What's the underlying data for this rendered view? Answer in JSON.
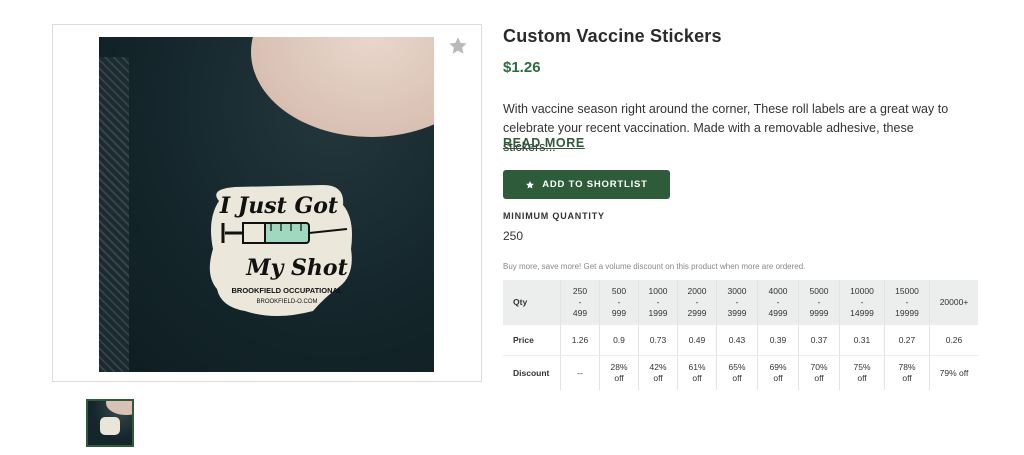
{
  "product": {
    "title": "Custom Vaccine Stickers",
    "price": "$1.26",
    "description": "With vaccine season right around the corner, These roll labels are a great way to celebrate your recent vaccination. Made with a removable adhesive, these stickers...",
    "read_more": "READ MORE",
    "add_to_shortlist": "ADD TO SHORTLIST",
    "min_quantity_label": "MINIMUM QUANTITY",
    "min_quantity_value": "250",
    "volume_note": "Buy more, save more! Get a volume discount on this product when more are ordered."
  },
  "gallery": {
    "sticker_text": {
      "line1": "I Just Got",
      "line2": "My Shot",
      "company": "BROOKFIELD OCCUPATIONAL",
      "website": "BROOKFIELD-O.COM"
    },
    "icons": {
      "favorite": "star-icon",
      "button": "star-icon"
    }
  },
  "pricing_table": {
    "row_labels": {
      "qty": "Qty",
      "price": "Price",
      "discount": "Discount"
    },
    "columns": [
      {
        "qty_top": "250",
        "qty_sep": "-",
        "qty_bottom": "499",
        "price": "1.26",
        "discount_top": "--",
        "discount_bottom": ""
      },
      {
        "qty_top": "500",
        "qty_sep": "-",
        "qty_bottom": "999",
        "price": "0.9",
        "discount_top": "28%",
        "discount_bottom": "off"
      },
      {
        "qty_top": "1000",
        "qty_sep": "-",
        "qty_bottom": "1999",
        "price": "0.73",
        "discount_top": "42%",
        "discount_bottom": "off"
      },
      {
        "qty_top": "2000",
        "qty_sep": "-",
        "qty_bottom": "2999",
        "price": "0.49",
        "discount_top": "61%",
        "discount_bottom": "off"
      },
      {
        "qty_top": "3000",
        "qty_sep": "-",
        "qty_bottom": "3999",
        "price": "0.43",
        "discount_top": "65%",
        "discount_bottom": "off"
      },
      {
        "qty_top": "4000",
        "qty_sep": "-",
        "qty_bottom": "4999",
        "price": "0.39",
        "discount_top": "69%",
        "discount_bottom": "off"
      },
      {
        "qty_top": "5000",
        "qty_sep": "-",
        "qty_bottom": "9999",
        "price": "0.37",
        "discount_top": "70%",
        "discount_bottom": "off"
      },
      {
        "qty_top": "10000",
        "qty_sep": "-",
        "qty_bottom": "14999",
        "price": "0.31",
        "discount_top": "75%",
        "discount_bottom": "off"
      },
      {
        "qty_top": "15000",
        "qty_sep": "-",
        "qty_bottom": "19999",
        "price": "0.27",
        "discount_top": "78%",
        "discount_bottom": "off"
      },
      {
        "qty_top": "20000+",
        "qty_sep": "",
        "qty_bottom": "",
        "price": "0.26",
        "discount_top": "79% off",
        "discount_bottom": ""
      }
    ]
  },
  "colors": {
    "brand_green": "#2e5b3a",
    "price_green": "#2e6b3e",
    "table_header_bg": "#ebeeec"
  }
}
